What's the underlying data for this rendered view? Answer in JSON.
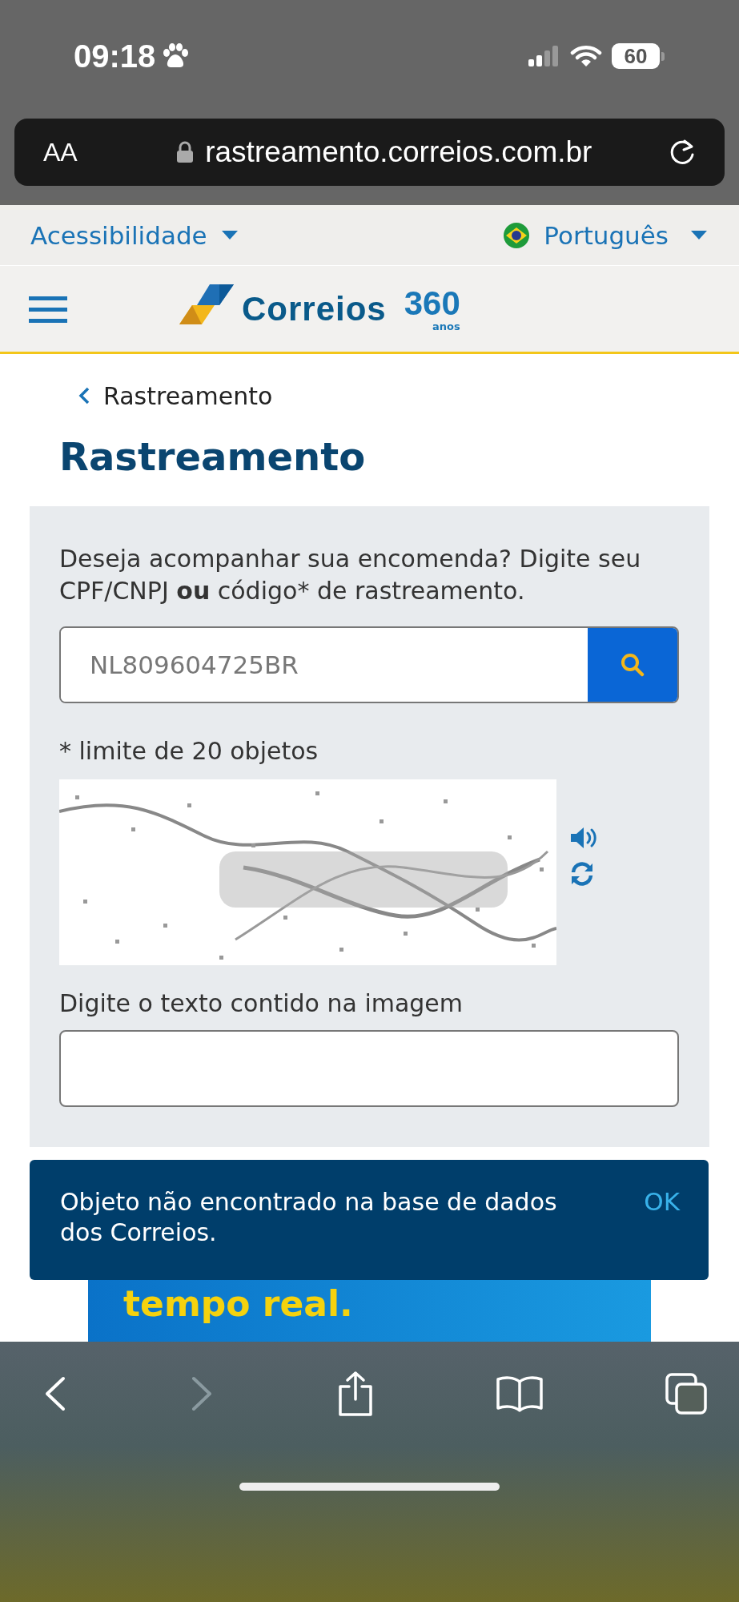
{
  "status_bar": {
    "time": "09:18",
    "battery": "60"
  },
  "address_bar": {
    "text_size": "AA",
    "url": "rastreamento.correios.com.br"
  },
  "top_bar": {
    "accessibility": "Acessibilidade",
    "language": "Português"
  },
  "header": {
    "logo": {
      "name": "Correios",
      "number": "360",
      "caption": "anos"
    }
  },
  "breadcrumb": "Rastreamento",
  "title": "Rastreamento",
  "form": {
    "prompt": "Deseja acompanhar sua encomenda? Digite seu CPF/CNPJ **ou** código* de rastreamento.",
    "tracking_field": {
      "value": "NL809604725BR"
    },
    "limit_note": "* limite de 20 objetos",
    "captcha_label": "Digite o texto contido na imagem"
  },
  "alert": {
    "message": "Objeto não encontrado na base de dados dos Correios.",
    "action": "OK"
  },
  "banner": {
    "text": "tempo real."
  },
  "toolbar": [
    {
      "kind": "back",
      "disabled": false
    },
    {
      "kind": "forward",
      "disabled": true
    },
    {
      "kind": "share",
      "disabled": false
    },
    {
      "kind": "bookmarks",
      "disabled": false
    },
    {
      "kind": "tabs",
      "disabled": false
    }
  ]
}
